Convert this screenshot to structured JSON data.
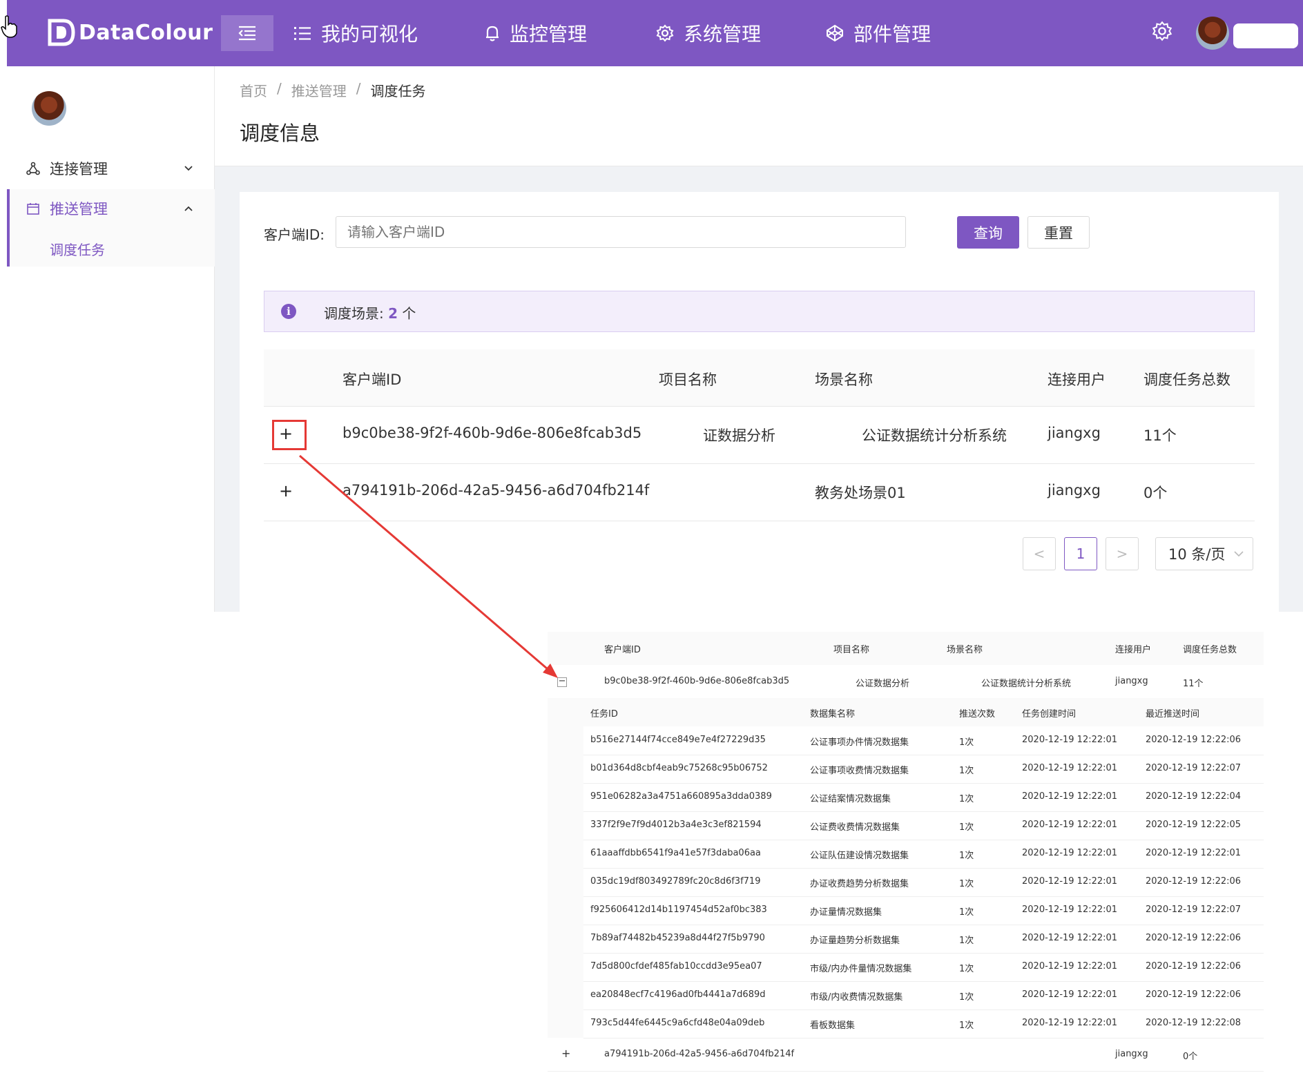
{
  "app": {
    "logo_text": "DataColour"
  },
  "topnav": {
    "items": [
      "我的可视化",
      "监控管理",
      "系统管理",
      "部件管理"
    ]
  },
  "sidebar": {
    "items": [
      {
        "label": "连接管理"
      },
      {
        "label": "推送管理",
        "sub": [
          "调度任务"
        ]
      }
    ]
  },
  "breadcrumb": [
    "首页",
    "推送管理",
    "调度任务"
  ],
  "breadcrumb_sep": "/",
  "page_title": "调度信息",
  "search": {
    "label": "客户端ID:",
    "placeholder": "请输入客户端ID",
    "query_label": "查询",
    "reset_label": "重置"
  },
  "alert": {
    "prefix": "调度场景:",
    "count": "2",
    "suffix": "个"
  },
  "table": {
    "headers": [
      "客户端ID",
      "项目名称",
      "场景名称",
      "连接用户",
      "调度任务总数"
    ],
    "rows": [
      {
        "client_id": "b9c0be38-9f2f-460b-9d6e-806e8fcab3d5",
        "project": "证数据分析",
        "scene": "公证数据统计分析系统",
        "user": "jiangxg",
        "count": "11个",
        "expand": "+"
      },
      {
        "client_id": "a794191b-206d-42a5-9456-a6d704fb214f",
        "project": "",
        "scene": "教务处场景01",
        "user": "jiangxg",
        "count": "0个",
        "expand": "+"
      }
    ]
  },
  "pagination": {
    "prev": "<",
    "current": "1",
    "next": ">",
    "page_size": "10 条/页"
  },
  "inset": {
    "headers": [
      "客户端ID",
      "项目名称",
      "场景名称",
      "连接用户",
      "调度任务总数"
    ],
    "row1": {
      "expand": "−",
      "client_id": "b9c0be38-9f2f-460b-9d6e-806e8fcab3d5",
      "project": "公证数据分析",
      "scene": "公证数据统计分析系统",
      "user": "jiangxg",
      "count": "11个"
    },
    "sub_headers": [
      "任务ID",
      "数据集名称",
      "推送次数",
      "任务创建时间",
      "最近推送时间"
    ],
    "sub_rows": [
      [
        "b516e27144f74cce849e7e4f27229d35",
        "公证事项办件情况数据集",
        "1次",
        "2020-12-19 12:22:01",
        "2020-12-19 12:22:06"
      ],
      [
        "b01d364d8cbf4eab9c75268c95b06752",
        "公证事项收费情况数据集",
        "1次",
        "2020-12-19 12:22:01",
        "2020-12-19 12:22:07"
      ],
      [
        "951e06282a3a4751a660895a3dda0389",
        "公证结案情况数据集",
        "1次",
        "2020-12-19 12:22:01",
        "2020-12-19 12:22:04"
      ],
      [
        "337f2f9e7f9d4012b3a4e3c3ef821594",
        "公证费收费情况数据集",
        "1次",
        "2020-12-19 12:22:01",
        "2020-12-19 12:22:05"
      ],
      [
        "61aaaffdbb6541f9a41e57f3daba06aa",
        "公证队伍建设情况数据集",
        "1次",
        "2020-12-19 12:22:01",
        "2020-12-19 12:22:01"
      ],
      [
        "035dc19df803492789fc20c8d6f3f719",
        "办证收费趋势分析数据集",
        "1次",
        "2020-12-19 12:22:01",
        "2020-12-19 12:22:06"
      ],
      [
        "f925606412d14b1197454d52af0bc383",
        "办证量情况数据集",
        "1次",
        "2020-12-19 12:22:01",
        "2020-12-19 12:22:07"
      ],
      [
        "7b89af74482b45239a8d44f27f5b9790",
        "办证量趋势分析数据集",
        "1次",
        "2020-12-19 12:22:01",
        "2020-12-19 12:22:06"
      ],
      [
        "7d5d800cfdef485fab10ccdd3e95ea07",
        "市级/内办件量情况数据集",
        "1次",
        "2020-12-19 12:22:01",
        "2020-12-19 12:22:06"
      ],
      [
        "ea20848ecf7c4196ad0fb4441a7d689d",
        "市级/内收费情况数据集",
        "1次",
        "2020-12-19 12:22:01",
        "2020-12-19 12:22:06"
      ],
      [
        "793c5d44fe6445c9a6cfd48e04a09deb",
        "看板数据集",
        "1次",
        "2020-12-19 12:22:01",
        "2020-12-19 12:22:08"
      ]
    ],
    "row2": {
      "expand": "+",
      "client_id": "a794191b-206d-42a5-9456-a6d704fb214f",
      "user": "jiangxg",
      "count": "0个"
    }
  },
  "colors": {
    "brand": "#7e57c2",
    "annotation": "#e53935"
  }
}
